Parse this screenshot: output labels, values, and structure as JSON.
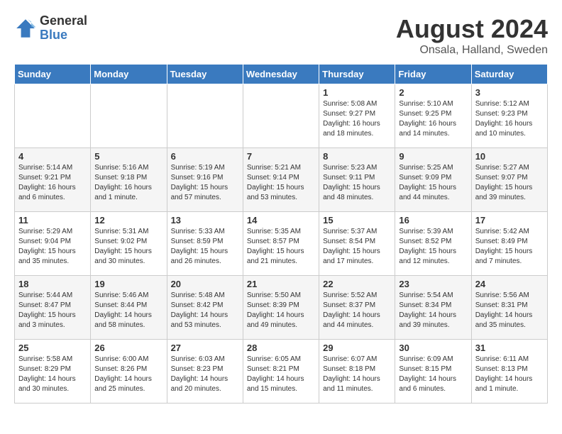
{
  "logo": {
    "line1": "General",
    "line2": "Blue"
  },
  "title": "August 2024",
  "subtitle": "Onsala, Halland, Sweden",
  "headers": [
    "Sunday",
    "Monday",
    "Tuesday",
    "Wednesday",
    "Thursday",
    "Friday",
    "Saturday"
  ],
  "weeks": [
    [
      {
        "day": "",
        "sunrise": "",
        "sunset": "",
        "daylight": ""
      },
      {
        "day": "",
        "sunrise": "",
        "sunset": "",
        "daylight": ""
      },
      {
        "day": "",
        "sunrise": "",
        "sunset": "",
        "daylight": ""
      },
      {
        "day": "",
        "sunrise": "",
        "sunset": "",
        "daylight": ""
      },
      {
        "day": "1",
        "sunrise": "Sunrise: 5:08 AM",
        "sunset": "Sunset: 9:27 PM",
        "daylight": "Daylight: 16 hours and 18 minutes."
      },
      {
        "day": "2",
        "sunrise": "Sunrise: 5:10 AM",
        "sunset": "Sunset: 9:25 PM",
        "daylight": "Daylight: 16 hours and 14 minutes."
      },
      {
        "day": "3",
        "sunrise": "Sunrise: 5:12 AM",
        "sunset": "Sunset: 9:23 PM",
        "daylight": "Daylight: 16 hours and 10 minutes."
      }
    ],
    [
      {
        "day": "4",
        "sunrise": "Sunrise: 5:14 AM",
        "sunset": "Sunset: 9:21 PM",
        "daylight": "Daylight: 16 hours and 6 minutes."
      },
      {
        "day": "5",
        "sunrise": "Sunrise: 5:16 AM",
        "sunset": "Sunset: 9:18 PM",
        "daylight": "Daylight: 16 hours and 1 minute."
      },
      {
        "day": "6",
        "sunrise": "Sunrise: 5:19 AM",
        "sunset": "Sunset: 9:16 PM",
        "daylight": "Daylight: 15 hours and 57 minutes."
      },
      {
        "day": "7",
        "sunrise": "Sunrise: 5:21 AM",
        "sunset": "Sunset: 9:14 PM",
        "daylight": "Daylight: 15 hours and 53 minutes."
      },
      {
        "day": "8",
        "sunrise": "Sunrise: 5:23 AM",
        "sunset": "Sunset: 9:11 PM",
        "daylight": "Daylight: 15 hours and 48 minutes."
      },
      {
        "day": "9",
        "sunrise": "Sunrise: 5:25 AM",
        "sunset": "Sunset: 9:09 PM",
        "daylight": "Daylight: 15 hours and 44 minutes."
      },
      {
        "day": "10",
        "sunrise": "Sunrise: 5:27 AM",
        "sunset": "Sunset: 9:07 PM",
        "daylight": "Daylight: 15 hours and 39 minutes."
      }
    ],
    [
      {
        "day": "11",
        "sunrise": "Sunrise: 5:29 AM",
        "sunset": "Sunset: 9:04 PM",
        "daylight": "Daylight: 15 hours and 35 minutes."
      },
      {
        "day": "12",
        "sunrise": "Sunrise: 5:31 AM",
        "sunset": "Sunset: 9:02 PM",
        "daylight": "Daylight: 15 hours and 30 minutes."
      },
      {
        "day": "13",
        "sunrise": "Sunrise: 5:33 AM",
        "sunset": "Sunset: 8:59 PM",
        "daylight": "Daylight: 15 hours and 26 minutes."
      },
      {
        "day": "14",
        "sunrise": "Sunrise: 5:35 AM",
        "sunset": "Sunset: 8:57 PM",
        "daylight": "Daylight: 15 hours and 21 minutes."
      },
      {
        "day": "15",
        "sunrise": "Sunrise: 5:37 AM",
        "sunset": "Sunset: 8:54 PM",
        "daylight": "Daylight: 15 hours and 17 minutes."
      },
      {
        "day": "16",
        "sunrise": "Sunrise: 5:39 AM",
        "sunset": "Sunset: 8:52 PM",
        "daylight": "Daylight: 15 hours and 12 minutes."
      },
      {
        "day": "17",
        "sunrise": "Sunrise: 5:42 AM",
        "sunset": "Sunset: 8:49 PM",
        "daylight": "Daylight: 15 hours and 7 minutes."
      }
    ],
    [
      {
        "day": "18",
        "sunrise": "Sunrise: 5:44 AM",
        "sunset": "Sunset: 8:47 PM",
        "daylight": "Daylight: 15 hours and 3 minutes."
      },
      {
        "day": "19",
        "sunrise": "Sunrise: 5:46 AM",
        "sunset": "Sunset: 8:44 PM",
        "daylight": "Daylight: 14 hours and 58 minutes."
      },
      {
        "day": "20",
        "sunrise": "Sunrise: 5:48 AM",
        "sunset": "Sunset: 8:42 PM",
        "daylight": "Daylight: 14 hours and 53 minutes."
      },
      {
        "day": "21",
        "sunrise": "Sunrise: 5:50 AM",
        "sunset": "Sunset: 8:39 PM",
        "daylight": "Daylight: 14 hours and 49 minutes."
      },
      {
        "day": "22",
        "sunrise": "Sunrise: 5:52 AM",
        "sunset": "Sunset: 8:37 PM",
        "daylight": "Daylight: 14 hours and 44 minutes."
      },
      {
        "day": "23",
        "sunrise": "Sunrise: 5:54 AM",
        "sunset": "Sunset: 8:34 PM",
        "daylight": "Daylight: 14 hours and 39 minutes."
      },
      {
        "day": "24",
        "sunrise": "Sunrise: 5:56 AM",
        "sunset": "Sunset: 8:31 PM",
        "daylight": "Daylight: 14 hours and 35 minutes."
      }
    ],
    [
      {
        "day": "25",
        "sunrise": "Sunrise: 5:58 AM",
        "sunset": "Sunset: 8:29 PM",
        "daylight": "Daylight: 14 hours and 30 minutes."
      },
      {
        "day": "26",
        "sunrise": "Sunrise: 6:00 AM",
        "sunset": "Sunset: 8:26 PM",
        "daylight": "Daylight: 14 hours and 25 minutes."
      },
      {
        "day": "27",
        "sunrise": "Sunrise: 6:03 AM",
        "sunset": "Sunset: 8:23 PM",
        "daylight": "Daylight: 14 hours and 20 minutes."
      },
      {
        "day": "28",
        "sunrise": "Sunrise: 6:05 AM",
        "sunset": "Sunset: 8:21 PM",
        "daylight": "Daylight: 14 hours and 15 minutes."
      },
      {
        "day": "29",
        "sunrise": "Sunrise: 6:07 AM",
        "sunset": "Sunset: 8:18 PM",
        "daylight": "Daylight: 14 hours and 11 minutes."
      },
      {
        "day": "30",
        "sunrise": "Sunrise: 6:09 AM",
        "sunset": "Sunset: 8:15 PM",
        "daylight": "Daylight: 14 hours and 6 minutes."
      },
      {
        "day": "31",
        "sunrise": "Sunrise: 6:11 AM",
        "sunset": "Sunset: 8:13 PM",
        "daylight": "Daylight: 14 hours and 1 minute."
      }
    ]
  ]
}
